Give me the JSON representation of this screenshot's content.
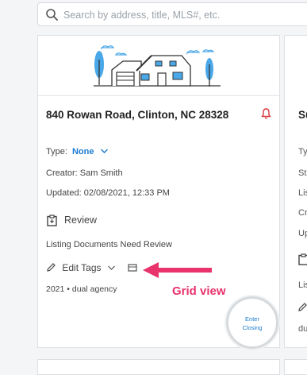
{
  "search": {
    "placeholder": "Search by address, title, MLS#, etc."
  },
  "card": {
    "address": "840 Rowan Road, Clinton, NC 28328",
    "type_label": "Type:",
    "type_value": "None",
    "creator": "Creator: Sam Smith",
    "updated": "Updated: 02/08/2021, 12:33 PM",
    "review_label": "Review",
    "status_text": "Listing Documents Need Review",
    "edit_tags_label": "Edit Tags",
    "tags_text": "2021 • dual agency",
    "enter_line1": "Enter",
    "enter_line2": "Closing"
  },
  "annotation": {
    "text": "Grid view",
    "color": "#e8336d"
  },
  "peek_card": {
    "title_fragment": "Su",
    "lines": [
      "Ty",
      "St",
      "Lis",
      "Cr",
      "Up",
      "Lis",
      "du"
    ]
  },
  "colors": {
    "accent": "#1b7bd0",
    "bell": "#d9363e",
    "illustration_blue": "#4aa8e8"
  }
}
